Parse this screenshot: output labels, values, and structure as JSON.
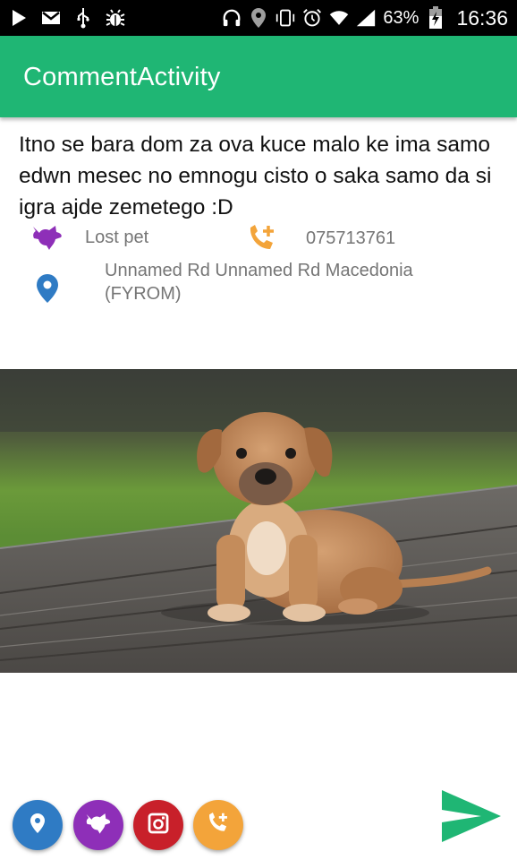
{
  "status_bar": {
    "battery_percent": "63%",
    "time": "16:36",
    "icons": [
      "play-icon",
      "gmail-icon",
      "usb-icon",
      "debug-icon",
      "headset-icon",
      "location-icon",
      "vibrate-icon",
      "alarm-icon",
      "wifi-icon",
      "signal-icon",
      "battery-icon"
    ]
  },
  "app_bar": {
    "title": "CommentActivity",
    "color": "#1fb674"
  },
  "post": {
    "text": "Itno se bara dom za ova kuce malo ke ima samo edwn mesec no emnogu cisto o saka samo da si igra ajde zemetego :D",
    "category_label": "Lost pet",
    "phone": "075713761",
    "address": "Unnamed Rd Unnamed Rd Macedonia (FYROM)"
  },
  "photo": {
    "subject": "puppy sitting on wooden deck"
  },
  "actions": [
    {
      "name": "location-button",
      "icon": "location-pin-icon",
      "color": "#2f7bc4"
    },
    {
      "name": "pet-button",
      "icon": "pet-icon",
      "color": "#8e2fb8"
    },
    {
      "name": "instagram-button",
      "icon": "instagram-icon",
      "color": "#c8202a"
    },
    {
      "name": "add-call-button",
      "icon": "add-call-icon",
      "color": "#f3a43a"
    }
  ],
  "send": {
    "icon": "send-icon",
    "color": "#1fb674"
  }
}
